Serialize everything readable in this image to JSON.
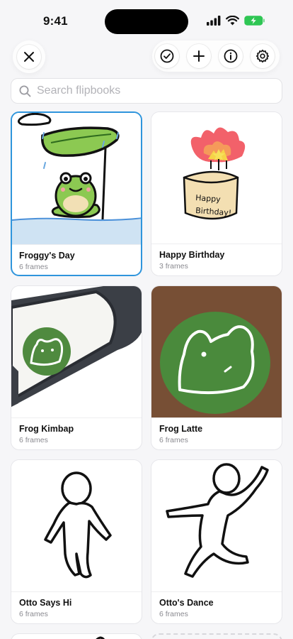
{
  "status": {
    "time": "9:41"
  },
  "search": {
    "placeholder": "Search flipbooks",
    "value": ""
  },
  "toolbar": {
    "close_icon": "close-icon",
    "actions": [
      "select-checkmark-icon",
      "add-plus-icon",
      "info-icon",
      "gear-icon"
    ]
  },
  "accent_color": "#2f95dc",
  "flipbooks": [
    {
      "title": "Froggy's Day",
      "frames": "6 frames",
      "selected": true
    },
    {
      "title": "Happy Birthday",
      "frames": "3 frames",
      "selected": false,
      "drawing_text": [
        "Happy",
        "Birthday!"
      ]
    },
    {
      "title": "Frog Kimbap",
      "frames": "6 frames",
      "selected": false
    },
    {
      "title": "Frog Latte",
      "frames": "6 frames",
      "selected": false
    },
    {
      "title": "Otto Says Hi",
      "frames": "6 frames",
      "selected": false
    },
    {
      "title": "Otto's Dance",
      "frames": "6 frames",
      "selected": false
    }
  ]
}
